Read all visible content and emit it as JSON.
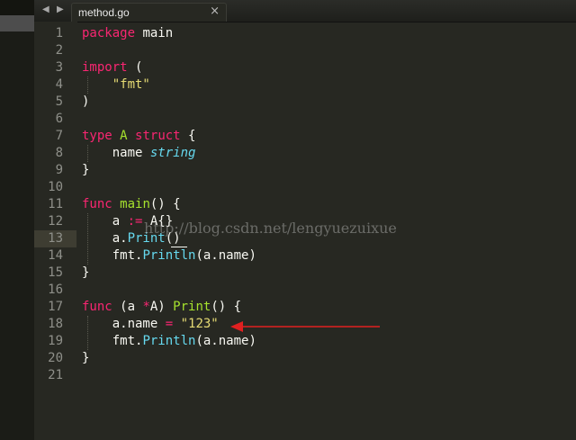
{
  "tab": {
    "filename": "method.go",
    "close_glyph": "×"
  },
  "nav": {
    "back_glyph": "◀",
    "forward_glyph": "▶"
  },
  "line_numbers": [
    "1",
    "2",
    "3",
    "4",
    "5",
    "6",
    "7",
    "8",
    "9",
    "10",
    "11",
    "12",
    "13",
    "14",
    "15",
    "16",
    "17",
    "18",
    "19",
    "20",
    "21"
  ],
  "code_lines": [
    [
      {
        "t": "package",
        "c": "kw"
      },
      {
        "t": " main",
        "c": ""
      }
    ],
    [],
    [
      {
        "t": "import",
        "c": "kw"
      },
      {
        "t": " (",
        "c": ""
      }
    ],
    [
      {
        "t": "    ",
        "c": ""
      },
      {
        "t": "\"fmt\"",
        "c": "str"
      }
    ],
    [
      {
        "t": ")",
        "c": ""
      }
    ],
    [],
    [
      {
        "t": "type",
        "c": "kw"
      },
      {
        "t": " ",
        "c": ""
      },
      {
        "t": "A",
        "c": "ty"
      },
      {
        "t": " ",
        "c": ""
      },
      {
        "t": "struct",
        "c": "kw"
      },
      {
        "t": " {",
        "c": ""
      }
    ],
    [
      {
        "t": "    name ",
        "c": ""
      },
      {
        "t": "string",
        "c": "tn"
      }
    ],
    [
      {
        "t": "}",
        "c": ""
      }
    ],
    [],
    [
      {
        "t": "func",
        "c": "kw"
      },
      {
        "t": " ",
        "c": ""
      },
      {
        "t": "main",
        "c": "fn"
      },
      {
        "t": "() {",
        "c": ""
      }
    ],
    [
      {
        "t": "    a ",
        "c": ""
      },
      {
        "t": ":=",
        "c": "op"
      },
      {
        "t": " A{}",
        "c": ""
      }
    ],
    [
      {
        "t": "    a.",
        "c": ""
      },
      {
        "t": "Print",
        "c": "call"
      },
      {
        "t": "()",
        "c": ""
      }
    ],
    [
      {
        "t": "    fmt.",
        "c": ""
      },
      {
        "t": "Println",
        "c": "call"
      },
      {
        "t": "(a.name)",
        "c": ""
      }
    ],
    [
      {
        "t": "}",
        "c": ""
      }
    ],
    [],
    [
      {
        "t": "func",
        "c": "kw"
      },
      {
        "t": " (a ",
        "c": ""
      },
      {
        "t": "*",
        "c": "op"
      },
      {
        "t": "A) ",
        "c": ""
      },
      {
        "t": "Print",
        "c": "fn"
      },
      {
        "t": "() {",
        "c": ""
      }
    ],
    [
      {
        "t": "    a.name ",
        "c": ""
      },
      {
        "t": "=",
        "c": "op"
      },
      {
        "t": " ",
        "c": ""
      },
      {
        "t": "\"123\"",
        "c": "str"
      }
    ],
    [
      {
        "t": "    fmt.",
        "c": ""
      },
      {
        "t": "Println",
        "c": "call"
      },
      {
        "t": "(a.name)",
        "c": ""
      }
    ],
    [
      {
        "t": "}",
        "c": ""
      }
    ],
    []
  ],
  "watermark": "http://blog.csdn.net/lengyuezuixue",
  "colors": {
    "background": "#272822",
    "keyword": "#f92672",
    "function": "#a6e22e",
    "type": "#66d9ef",
    "string": "#e6db74",
    "arrow": "#e02020"
  }
}
